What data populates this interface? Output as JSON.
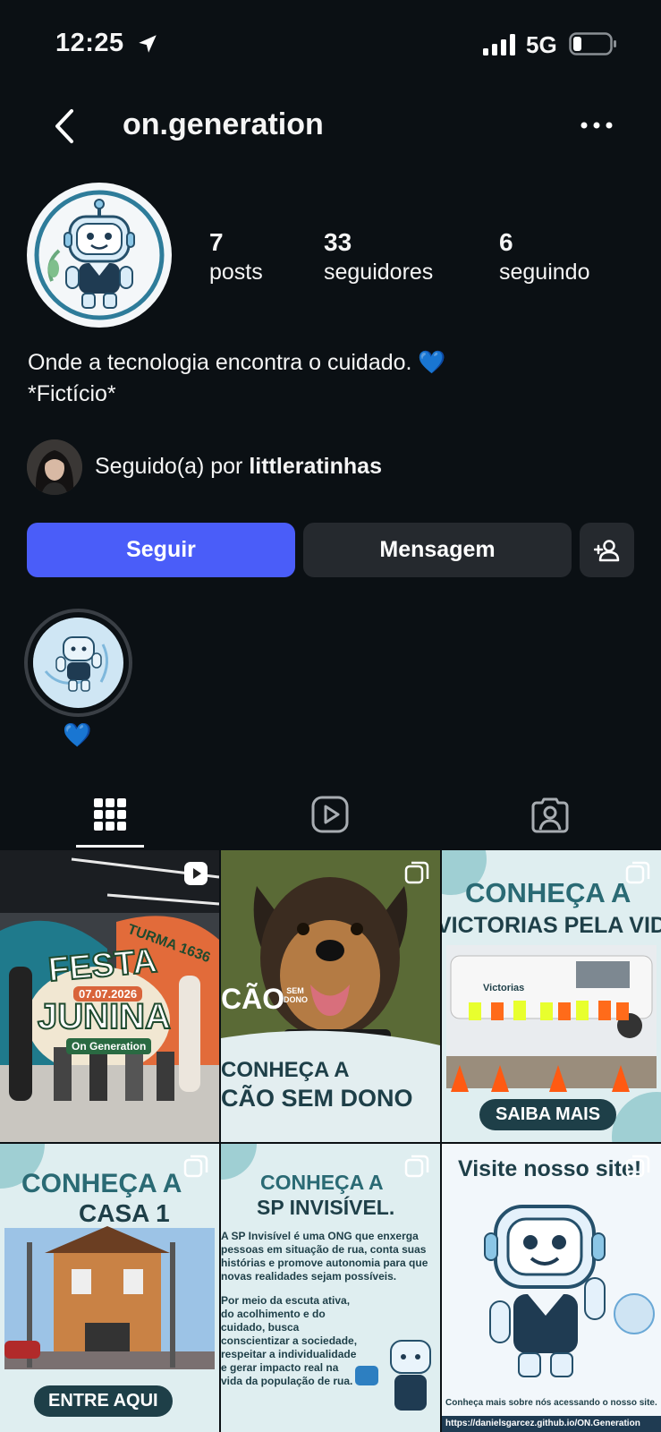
{
  "status_bar": {
    "time": "12:25",
    "network": "5G"
  },
  "header": {
    "username": "on.generation"
  },
  "stats": [
    {
      "count": "7",
      "label": "posts"
    },
    {
      "count": "33",
      "label": "seguidores"
    },
    {
      "count": "6",
      "label": "seguindo"
    }
  ],
  "bio": {
    "line1": "Onde a tecnologia encontra o cuidado. 💙",
    "line2": "*Fictício*"
  },
  "followed_by": {
    "prefix": "Seguido(a) por ",
    "name": "littleratinhas"
  },
  "buttons": {
    "follow": "Seguir",
    "message": "Mensagem"
  },
  "highlight": {
    "label": "💙"
  },
  "colors": {
    "accent": "#4a5df9",
    "background": "#0b1014",
    "button_dark": "#25292e"
  },
  "posts": [
    {
      "line1": "FESTA",
      "line2": "JUNINA",
      "date": "07.07.2026",
      "tag": "On Generation",
      "turma": "TURMA 1636",
      "kind": "reel"
    },
    {
      "line1": "CONHEÇA A",
      "line2": "CÃO SEM DONO",
      "logo": "CÃO",
      "logo_small": "SEM DONO",
      "kind": "carousel"
    },
    {
      "line1": "CONHEÇA A",
      "line2": "VICTORIAS PELA VIDA",
      "cta": "SAIBA MAIS",
      "van": "Victorias",
      "kind": "carousel"
    },
    {
      "line1": "CONHEÇA A",
      "line2": "CASA 1",
      "cta": "ENTRE AQUI",
      "kind": "carousel"
    },
    {
      "line1": "CONHEÇA A",
      "line2": "SP INVISÍVEL.",
      "para1": "A SP Invisível é uma ONG que enxerga pessoas em situação de rua, conta suas histórias e promove autonomia para que novas realidades sejam possíveis.",
      "para2": "Por meio da escuta ativa, do acolhimento e do cuidado, busca conscientizar a sociedade, respeitar a individualidade e gerar impacto real na vida da população de rua.",
      "kind": "carousel"
    },
    {
      "line1": "Visite nosso site!",
      "footer": "Conheça mais sobre nós acessando o nosso site.",
      "url": "https://danielsgarcez.github.io/ON.Generation",
      "kind": "carousel"
    }
  ]
}
